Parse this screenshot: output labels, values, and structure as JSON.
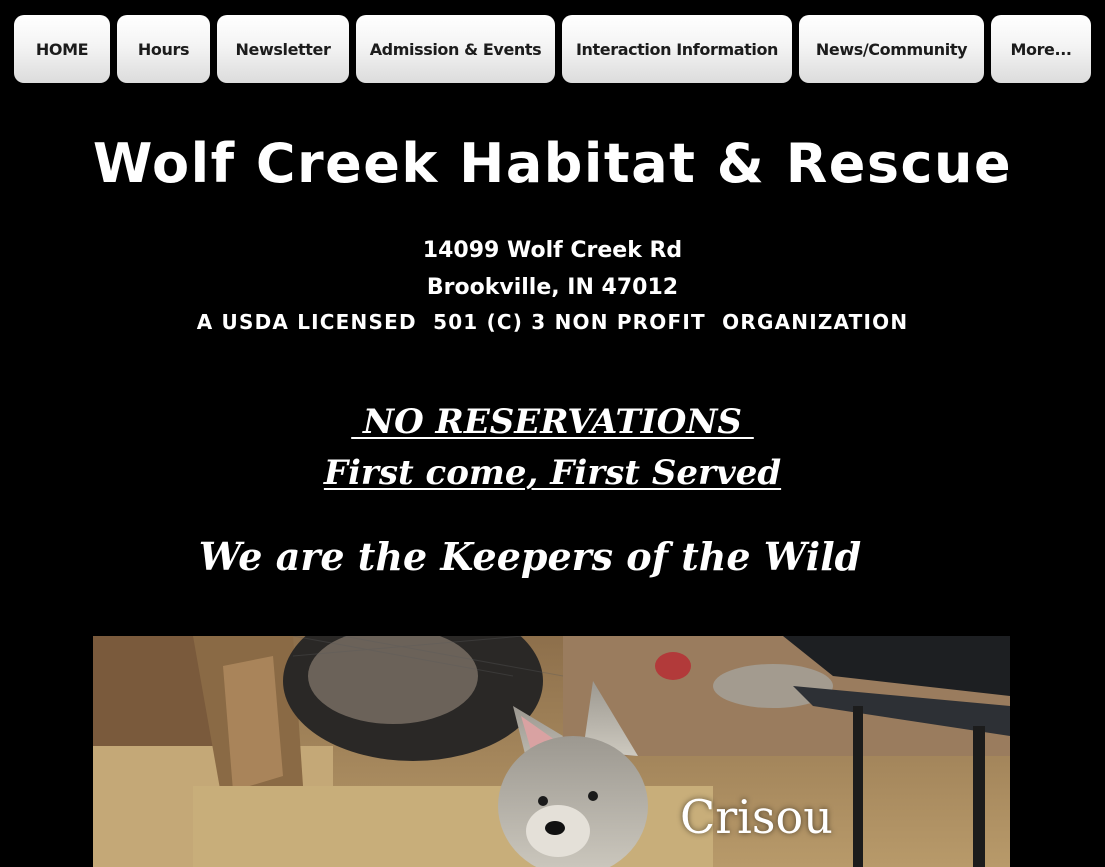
{
  "nav": {
    "items": [
      {
        "label": "HOME"
      },
      {
        "label": "Hours"
      },
      {
        "label": "Newsletter"
      },
      {
        "label": "Admission & Events"
      },
      {
        "label": "Interaction Information"
      },
      {
        "label": "News/Community"
      },
      {
        "label": "More..."
      }
    ]
  },
  "header": {
    "title": "Wolf Creek Habitat & Rescue",
    "address_line1": "14099 Wolf Creek Rd",
    "address_line2": "Brookville, IN 47012",
    "license": "A USDA LICENSED  501 (C) 3 NON PROFIT  ORGANIZATION"
  },
  "notice": {
    "line1": " NO RESERVATIONS ",
    "line2": "First come, First Served"
  },
  "tagline": "We are the Keepers of the Wild",
  "photo": {
    "caption": "Crisou"
  }
}
